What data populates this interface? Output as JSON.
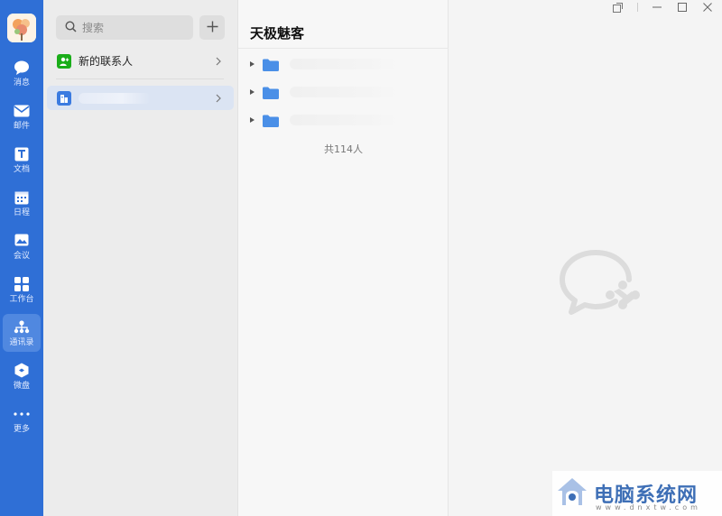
{
  "nav": {
    "items": [
      {
        "key": "messages",
        "label": "消息"
      },
      {
        "key": "mail",
        "label": "邮件"
      },
      {
        "key": "docs",
        "label": "文档"
      },
      {
        "key": "calendar",
        "label": "日程"
      },
      {
        "key": "meeting",
        "label": "会议"
      },
      {
        "key": "workbench",
        "label": "工作台"
      },
      {
        "key": "contacts",
        "label": "通讯录",
        "active": true
      },
      {
        "key": "drive",
        "label": "微盘"
      },
      {
        "key": "more",
        "label": "更多"
      }
    ],
    "accent": "#2f6fd6"
  },
  "contacts_panel": {
    "search_placeholder": "搜索",
    "add_icon": "plus-icon",
    "new_contacts_label": "新的联系人",
    "new_contacts_badge_color": "#1aad19",
    "org_badge_color": "#3b7be0"
  },
  "org": {
    "title": "天极魅客",
    "total_label": "共114人",
    "folder_color": "#4a8fe7"
  },
  "window": {
    "controls": [
      "popout-icon",
      "minimize-icon",
      "maximize-icon",
      "close-icon"
    ]
  },
  "watermark": {
    "text": "电脑系统网",
    "sub": "www.dnxtw.com"
  }
}
